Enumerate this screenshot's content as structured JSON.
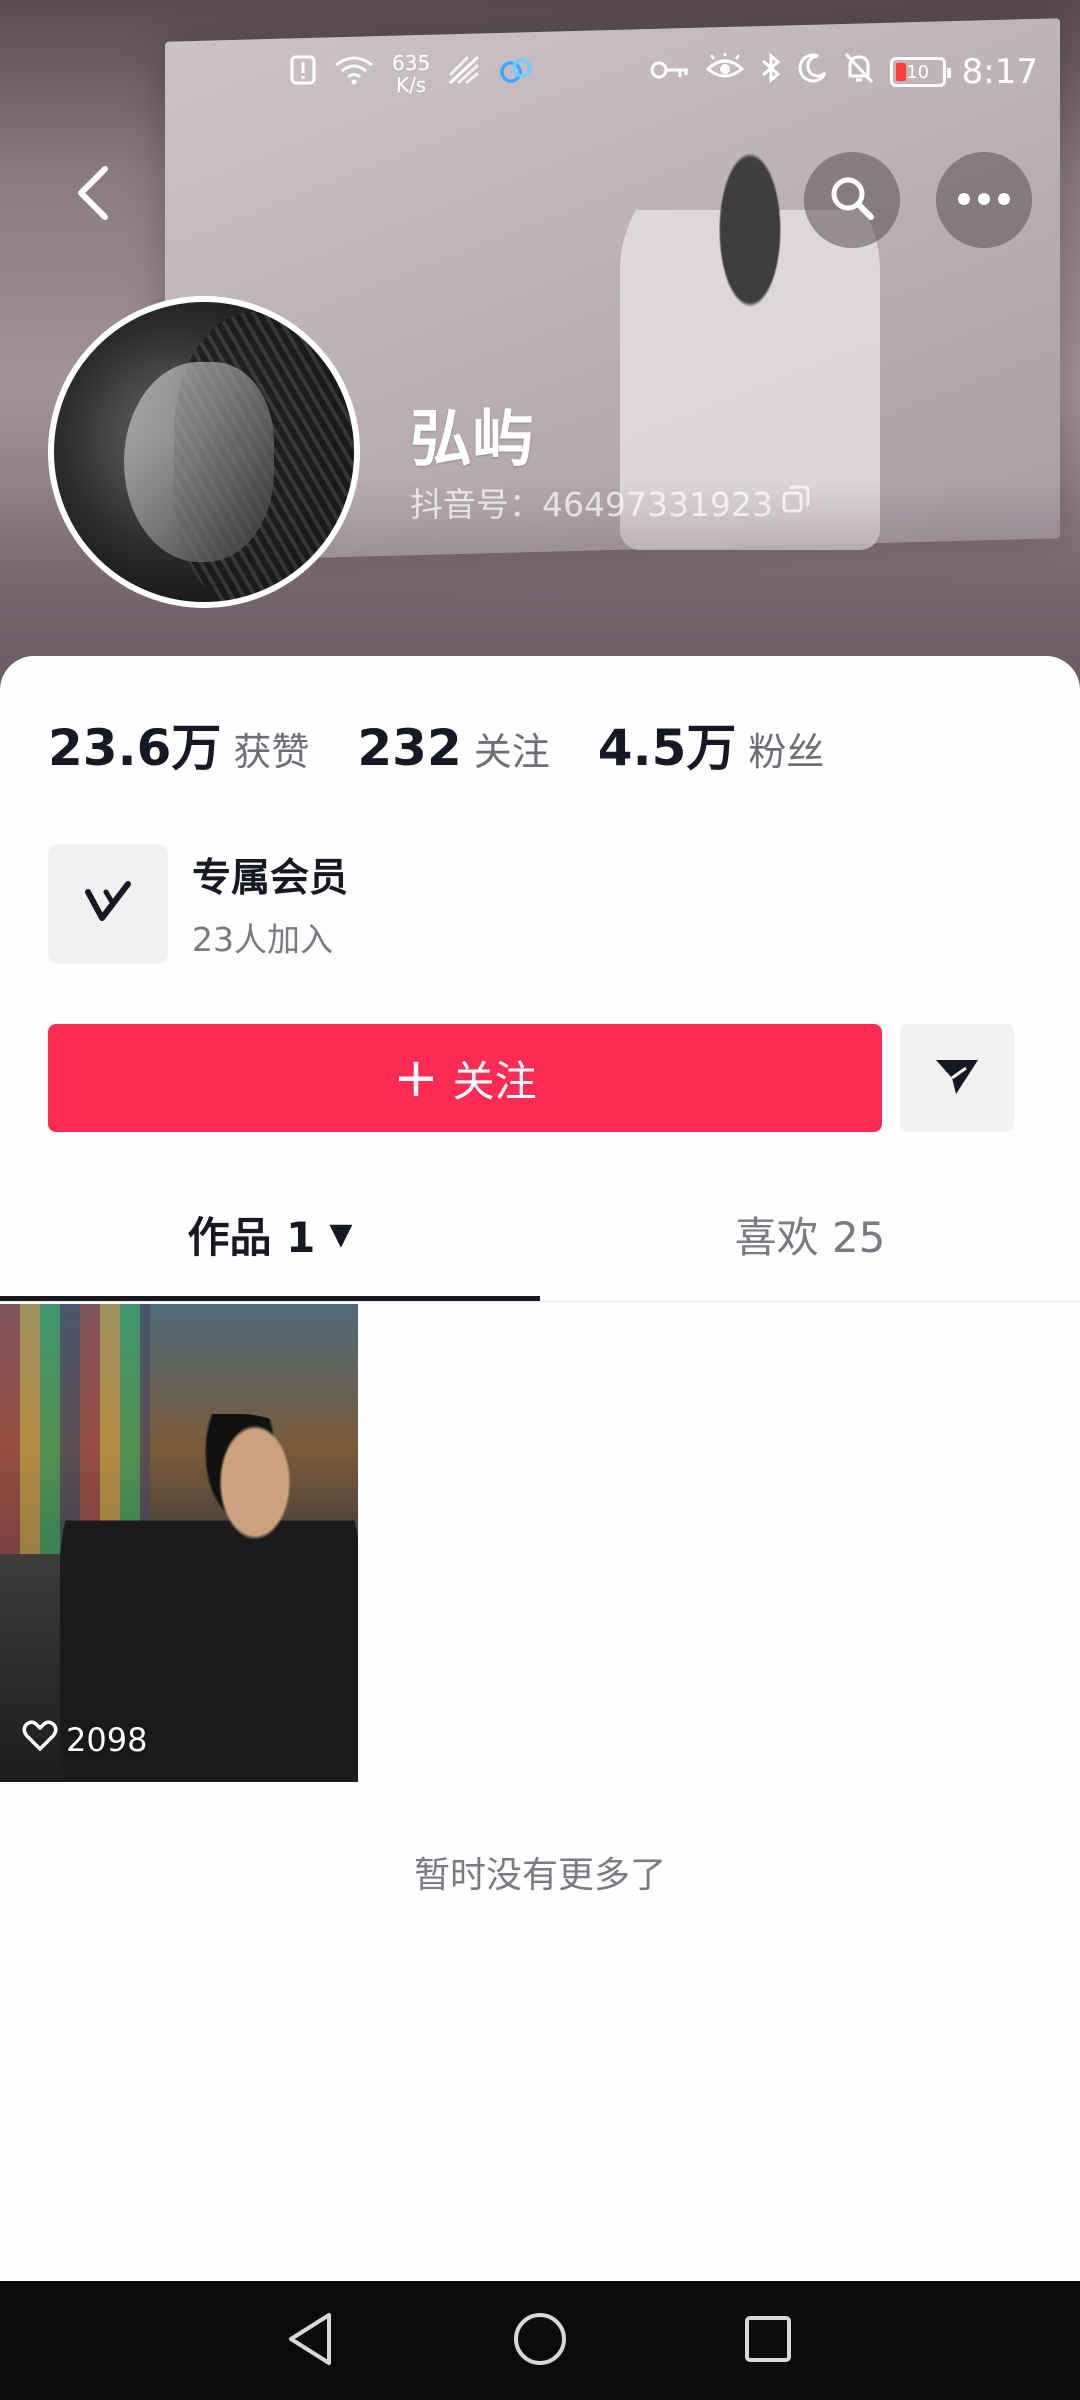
{
  "status_bar": {
    "net_speed_value": "635",
    "net_speed_unit": "K/s",
    "battery_level": "10",
    "time": "8:17"
  },
  "profile": {
    "name": "弘屿",
    "douyin_id": "抖音号：46497331923"
  },
  "stats": [
    {
      "value": "23.6万",
      "label": "获赞"
    },
    {
      "value": "232",
      "label": "关注"
    },
    {
      "value": "4.5万",
      "label": "粉丝"
    }
  ],
  "membership": {
    "title": "专属会员",
    "subtitle": "23人加入"
  },
  "actions": {
    "follow_plus": "+",
    "follow_label": "关注"
  },
  "tabs": {
    "works_label": "作品 1",
    "works_caret": "▼",
    "likes_label": "喜欢 25"
  },
  "videos": [
    {
      "likes": "2098"
    }
  ],
  "footer": {
    "no_more_text": "暂时没有更多了"
  },
  "colors": {
    "accent": "#fe2c55",
    "text_primary": "#161823",
    "text_secondary": "#7a7b82"
  },
  "icons": {
    "back": "chevron-left-icon",
    "search": "search-icon",
    "more": "more-horizontal-icon",
    "copy": "copy-icon",
    "membership": "membership-v-icon",
    "share": "send-icon",
    "like": "heart-icon"
  }
}
